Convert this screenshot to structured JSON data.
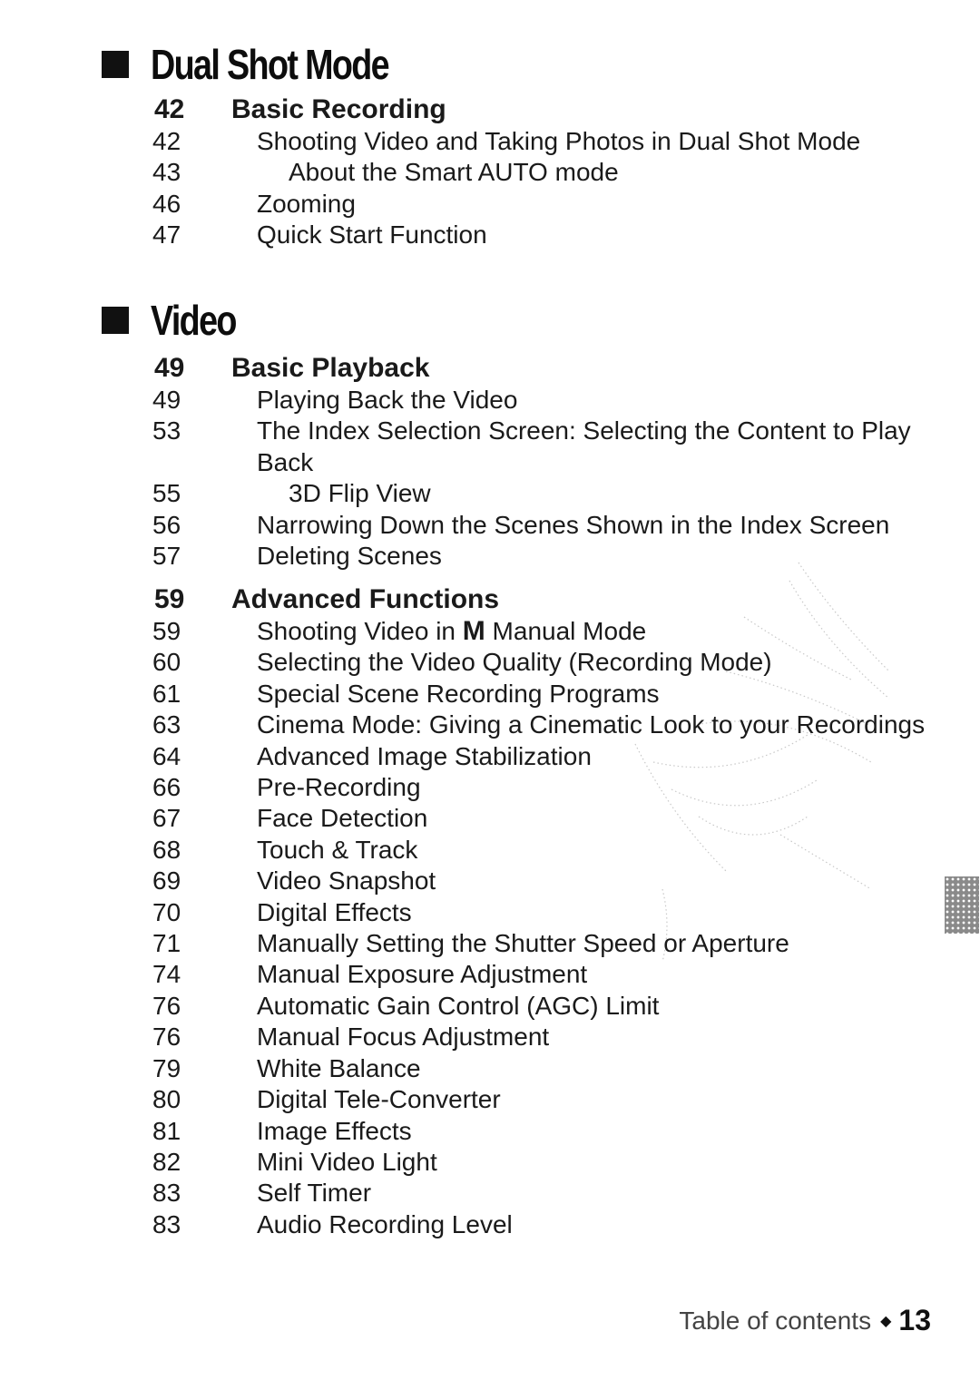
{
  "sections": [
    {
      "title": "Dual Shot Mode",
      "groups": [
        {
          "heading": {
            "page": "42",
            "label": "Basic Recording"
          },
          "entries": [
            {
              "page": "42",
              "label": "Shooting Video and Taking Photos in Dual Shot Mode",
              "sub": false
            },
            {
              "page": "43",
              "label": "About the Smart AUTO mode",
              "sub": true
            },
            {
              "page": "46",
              "label": "Zooming",
              "sub": false
            },
            {
              "page": "47",
              "label": "Quick Start Function",
              "sub": false
            }
          ]
        }
      ]
    },
    {
      "title": "Video",
      "groups": [
        {
          "heading": {
            "page": "49",
            "label": "Basic Playback"
          },
          "entries": [
            {
              "page": "49",
              "label": "Playing Back the Video",
              "sub": false
            },
            {
              "page": "53",
              "label": "The Index Selection Screen: Selecting the Content to Play Back",
              "sub": false
            },
            {
              "page": "55",
              "label": "3D Flip View",
              "sub": true
            },
            {
              "page": "56",
              "label": "Narrowing Down the Scenes Shown in the Index Screen",
              "sub": false
            },
            {
              "page": "57",
              "label": "Deleting Scenes",
              "sub": false
            }
          ]
        },
        {
          "heading": {
            "page": "59",
            "label": "Advanced Functions"
          },
          "entries": [
            {
              "page": "59",
              "label_before": "Shooting Video in ",
              "icon": "M",
              "label_after": " Manual Mode",
              "sub": false
            },
            {
              "page": "60",
              "label": "Selecting the Video Quality (Recording Mode)",
              "sub": false
            },
            {
              "page": "61",
              "label": "Special Scene Recording Programs",
              "sub": false
            },
            {
              "page": "63",
              "label": "Cinema Mode: Giving a Cinematic Look to your Recordings",
              "sub": false
            },
            {
              "page": "64",
              "label": "Advanced Image Stabilization",
              "sub": false
            },
            {
              "page": "66",
              "label": "Pre-Recording",
              "sub": false
            },
            {
              "page": "67",
              "label": "Face Detection",
              "sub": false
            },
            {
              "page": "68",
              "label": "Touch & Track",
              "sub": false
            },
            {
              "page": "69",
              "label": "Video Snapshot",
              "sub": false
            },
            {
              "page": "70",
              "label": "Digital Effects",
              "sub": false
            },
            {
              "page": "71",
              "label": "Manually Setting the Shutter Speed or Aperture",
              "sub": false
            },
            {
              "page": "74",
              "label": "Manual Exposure Adjustment",
              "sub": false
            },
            {
              "page": "76",
              "label": "Automatic Gain Control (AGC) Limit",
              "sub": false
            },
            {
              "page": "76",
              "label": "Manual Focus Adjustment",
              "sub": false
            },
            {
              "page": "79",
              "label": "White Balance",
              "sub": false
            },
            {
              "page": "80",
              "label": "Digital Tele-Converter",
              "sub": false
            },
            {
              "page": "81",
              "label": "Image Effects",
              "sub": false
            },
            {
              "page": "82",
              "label": "Mini Video Light",
              "sub": false
            },
            {
              "page": "83",
              "label": "Self Timer",
              "sub": false
            },
            {
              "page": "83",
              "label": "Audio Recording Level",
              "sub": false
            }
          ]
        }
      ]
    }
  ],
  "footer": {
    "label": "Table of contents",
    "separator": "◆",
    "page": "13"
  },
  "thumb_tab": {
    "color": "#8a8a8a"
  }
}
